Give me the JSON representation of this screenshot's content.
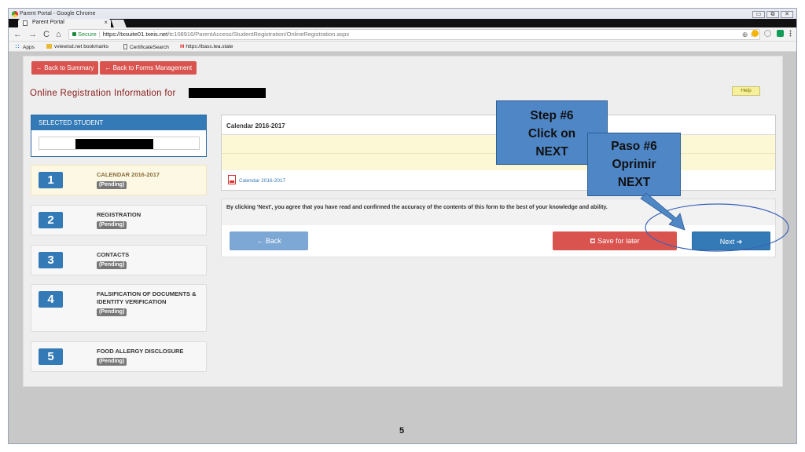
{
  "browser": {
    "window_title": "Parent Portal - Google Chrome",
    "tab_title": "Parent Portal",
    "tab_close": "×",
    "window_buttons": [
      "▭",
      "⧉",
      "✕"
    ],
    "nav": [
      "←",
      "→",
      "C",
      "⌂"
    ],
    "secure_label": "Secure",
    "url_host": "https://txsuite01.txeis.net",
    "url_path": "/tc108916/ParentAccess/StudentRegistration/OnlineRegistration.aspx",
    "url_right_icons": "⊕ ☆",
    "bookmarks": {
      "apps": "Apps",
      "bm1": "vviewisd.net bookmarks",
      "bm2": "CertificateSearch",
      "bm3": "https://bass.tea.state"
    }
  },
  "page": {
    "back_to_summary": "← Back to Summary",
    "back_to_forms": "← Back to Forms Management",
    "title": "Online Registration Information for",
    "help": "Help",
    "selected_student_header": "SELECTED STUDENT",
    "steps": [
      {
        "num": "1",
        "label": "CALENDAR 2016-2017",
        "status": "(Pending)"
      },
      {
        "num": "2",
        "label": "REGISTRATION",
        "status": "(Pending)"
      },
      {
        "num": "3",
        "label": "CONTACTS",
        "status": "(Pending)"
      },
      {
        "num": "4",
        "label": "FALSIFICATION OF DOCUMENTS & IDENTITY VERIFICATION",
        "status": "(Pending)"
      },
      {
        "num": "5",
        "label": "FOOD ALLERGY DISCLOSURE",
        "status": "(Pending)"
      }
    ],
    "calendar_header": "Calendar 2016-2017",
    "calendar_link": "Calendar 2016-2017",
    "agreement": "By clicking 'Next', you agree that you have read and confirmed the accuracy of the contents of this form to the best of your knowledge and ability.",
    "back_button": "← Back",
    "save_button": "Save for later",
    "next_button": "Next ➔"
  },
  "annotations": {
    "callout_en": [
      "Step #6",
      "Click on",
      "NEXT"
    ],
    "callout_es": [
      "Paso #6",
      "Oprimir",
      "NEXT"
    ],
    "accent_color": "#4f86c6"
  },
  "footer": {
    "slide_number": "5",
    "slide_number_faded": "5"
  }
}
